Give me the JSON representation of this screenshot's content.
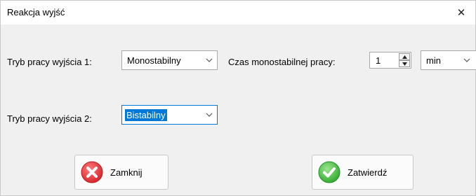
{
  "window": {
    "title": "Reakcja wyjść",
    "close_symbol": "✕"
  },
  "row1": {
    "mode_label": "Tryb pracy wyjścia 1:",
    "mode_value": "Monostabilny",
    "time_label": "Czas monostabilnej pracy:",
    "time_value": "1",
    "unit_value": "min"
  },
  "row2": {
    "mode_label": "Tryb pracy wyjścia 2:",
    "mode_value": "Bistabilny"
  },
  "buttons": {
    "close_label": "Zamknij",
    "confirm_label": "Zatwierdź"
  },
  "colors": {
    "close_icon": "#e6373b",
    "confirm_icon": "#3fbf3a",
    "focus": "#0078d7"
  }
}
